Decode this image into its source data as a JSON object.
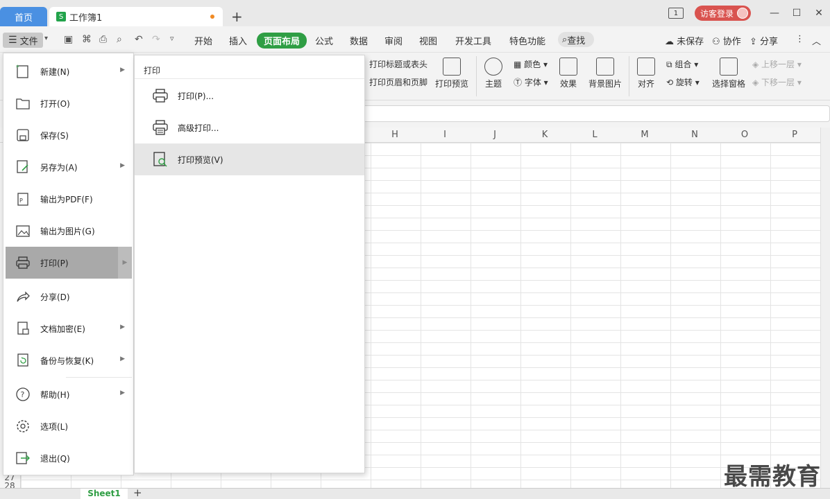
{
  "titlebar": {
    "home_tab": "首页",
    "doc_tab": "工作簿1",
    "doc_icon_letter": "S",
    "add_tab": "+",
    "box_icon_label": "1",
    "login_label": "访客登录",
    "minimize": "—",
    "maximize": "☐",
    "close": "✕"
  },
  "menubar": {
    "file_label": "文件",
    "tabs": [
      "开始",
      "插入",
      "页面布局",
      "公式",
      "数据",
      "审阅",
      "视图",
      "开发工具",
      "特色功能"
    ],
    "active_tab": "页面布局",
    "search_label": "查找",
    "unsaved": "未保存",
    "collab": "协作",
    "share": "分享"
  },
  "ribbon": {
    "print_titles": "打印标题或表头",
    "print_header_footer": "打印页眉和页脚",
    "print_preview": "打印预览",
    "theme": "主题",
    "colors": "颜色",
    "fonts": "字体",
    "effects": "效果",
    "background": "背景图片",
    "align": "对齐",
    "group": "组合",
    "rotate": "旋转",
    "selection_pane": "选择窗格",
    "bring_forward": "上移一层",
    "send_backward": "下移一层"
  },
  "grid": {
    "columns": [
      "H",
      "I",
      "J",
      "K",
      "L",
      "M",
      "N",
      "O",
      "P"
    ],
    "row_labels": [
      "27",
      "28"
    ]
  },
  "sheets": {
    "tabs": [
      "Sheet1"
    ],
    "add": "+"
  },
  "file_menu": {
    "items": [
      {
        "label": "新建(N)",
        "has_arrow": true
      },
      {
        "label": "打开(O)",
        "has_arrow": false
      },
      {
        "label": "保存(S)",
        "has_arrow": false
      },
      {
        "label": "另存为(A)",
        "has_arrow": true
      },
      {
        "label": "输出为PDF(F)",
        "has_arrow": false
      },
      {
        "label": "输出为图片(G)",
        "has_arrow": false
      },
      {
        "label": "打印(P)",
        "has_arrow": true
      },
      {
        "label": "分享(D)",
        "has_arrow": false
      },
      {
        "label": "文档加密(E)",
        "has_arrow": true
      },
      {
        "label": "备份与恢复(K)",
        "has_arrow": true
      },
      {
        "label": "帮助(H)",
        "has_arrow": true
      },
      {
        "label": "选项(L)",
        "has_arrow": false
      },
      {
        "label": "退出(Q)",
        "has_arrow": false
      }
    ],
    "active_item": "打印(P)"
  },
  "print_submenu": {
    "title": "打印",
    "items": [
      {
        "label": "打印(P)..."
      },
      {
        "label": "高级打印..."
      },
      {
        "label": "打印预览(V)"
      }
    ],
    "active_item": "打印预览(V)"
  },
  "watermark": "最需教育",
  "colors": {
    "accent_green": "#2f9e44",
    "home_tab_blue": "#4a90e2",
    "login_red": "#d9534f"
  }
}
